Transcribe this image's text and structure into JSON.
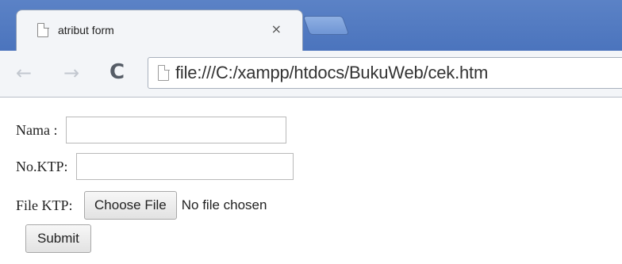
{
  "browser": {
    "tab": {
      "title": "atribut form",
      "close_glyph": "×",
      "icon": "page-icon"
    },
    "nav": {
      "back_glyph": "←",
      "forward_glyph": "→",
      "reload_glyph": "C"
    },
    "omnibox": {
      "url": "file:///C:/xampp/htdocs/BukuWeb/cek.htm",
      "icon": "page-icon"
    },
    "colors": {
      "tabstrip": "#4b74bd",
      "toolbar": "#f3f5f8"
    }
  },
  "form": {
    "nama": {
      "label": "Nama : ",
      "value": ""
    },
    "ktp": {
      "label": "No.KTP: ",
      "value": ""
    },
    "file": {
      "label": "File KTP: ",
      "button_label": "Choose File",
      "status": "No file chosen"
    },
    "submit_label": "Submit"
  }
}
